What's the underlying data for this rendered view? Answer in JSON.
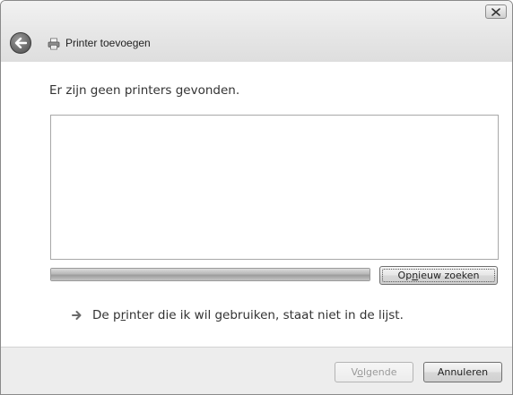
{
  "window": {
    "title": "Printer toevoegen"
  },
  "main": {
    "heading": "Er zijn geen printers gevonden.",
    "progress": 1.0,
    "search_again_button": {
      "pre": "Op",
      "accel": "n",
      "post": "ieuw zoeken"
    },
    "not_listed_link": {
      "pre": "De p",
      "accel": "r",
      "post": "inter die ik wil gebruiken, staat niet in de lijst."
    }
  },
  "footer": {
    "next_button": {
      "pre": "V",
      "accel": "o",
      "post": "lgende"
    },
    "cancel_button": "Annuleren"
  },
  "icons": {
    "back": "back-arrow-icon",
    "printer": "printer-icon",
    "close": "close-icon",
    "link_arrow": "arrow-right-icon"
  },
  "colors": {
    "footer_bg": "#ededed",
    "titlebar_bg": "#e6e6e6",
    "text": "#333333",
    "disabled_text": "#9a9a9a"
  }
}
